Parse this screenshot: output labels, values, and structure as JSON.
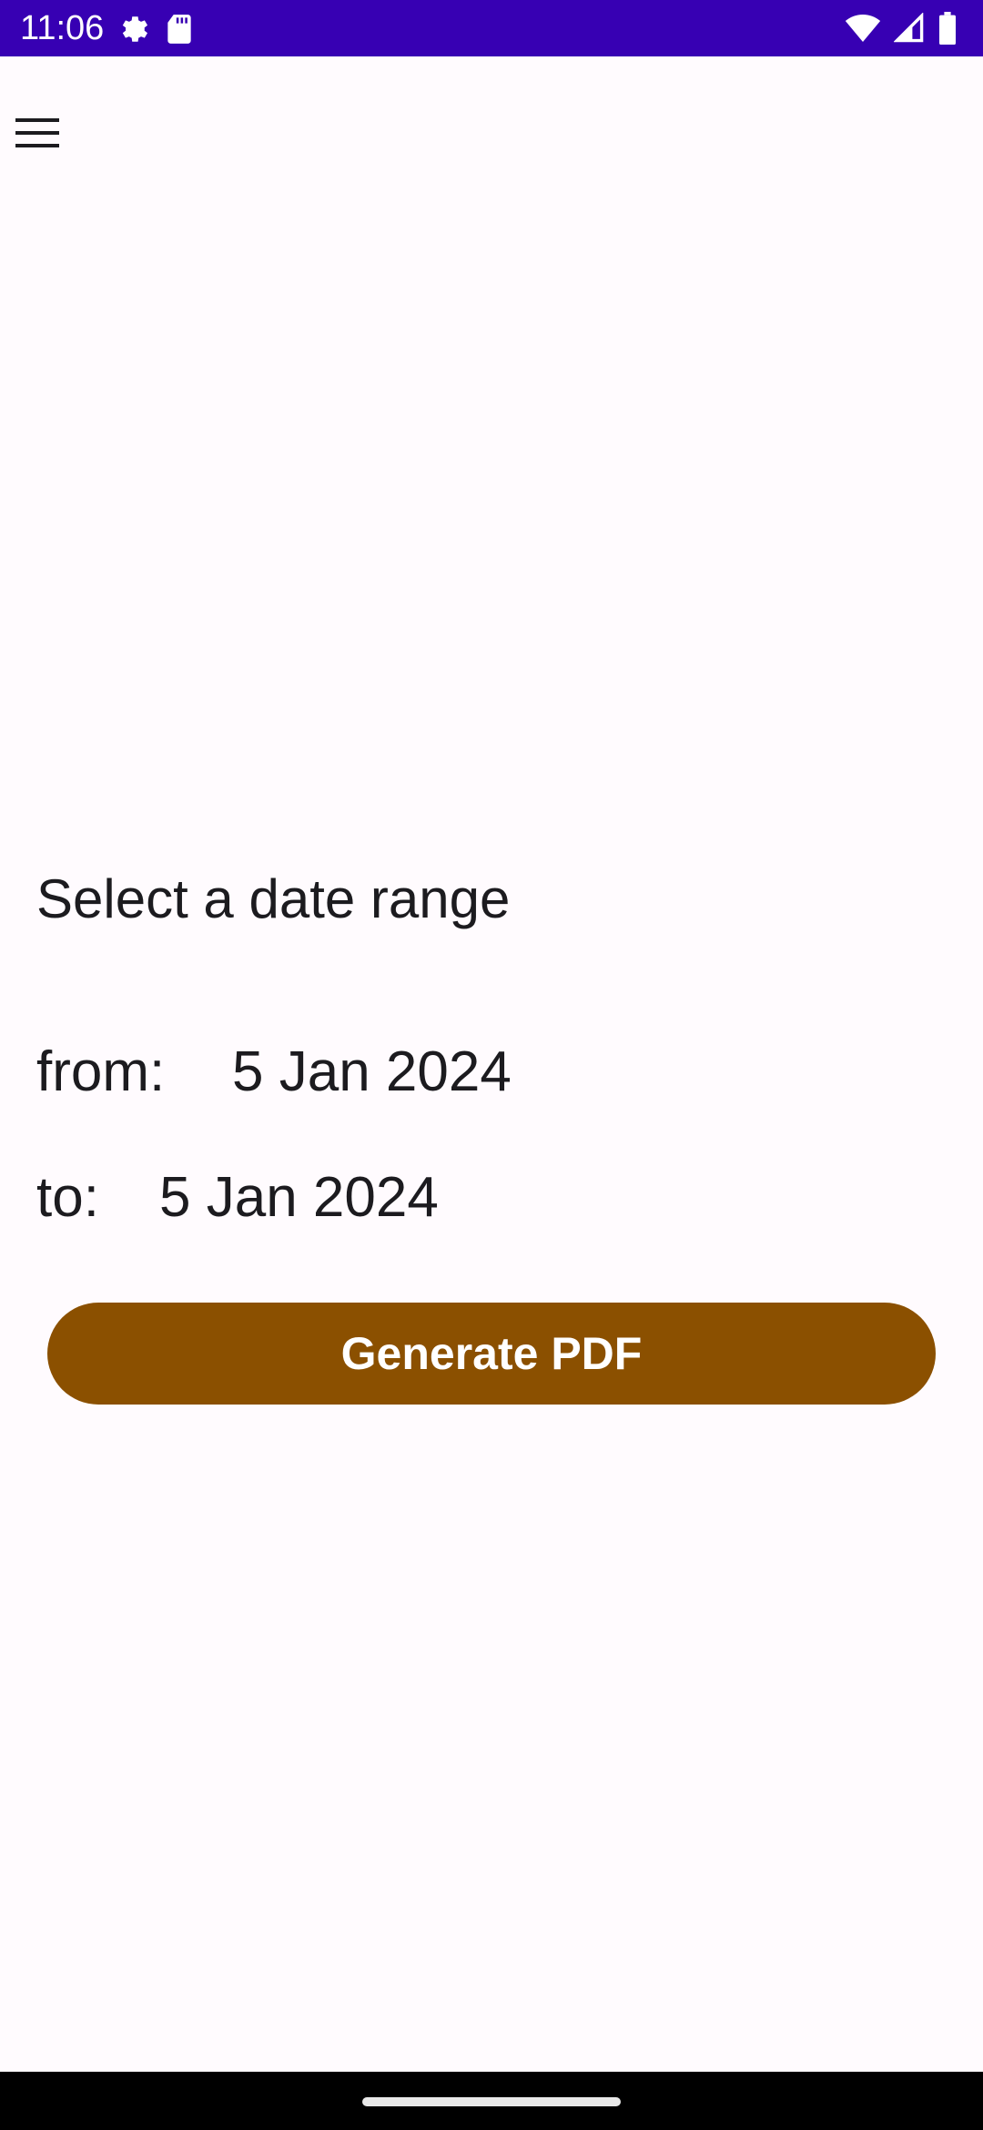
{
  "status_bar": {
    "time": "11:06",
    "left_icons": [
      "gear-icon",
      "sd-card-icon"
    ],
    "right_icons": [
      "wifi-icon",
      "signal-icon",
      "battery-icon"
    ],
    "background_color": "#3700b3"
  },
  "toolbar": {
    "menu_icon": "hamburger-menu-icon"
  },
  "date_range": {
    "title": "Select a date range",
    "from_label": "from:",
    "from_value": "5 Jan 2024",
    "to_label": "to:",
    "to_value": "5 Jan 2024"
  },
  "actions": {
    "generate_label": "Generate PDF",
    "button_color": "#8b5000"
  }
}
